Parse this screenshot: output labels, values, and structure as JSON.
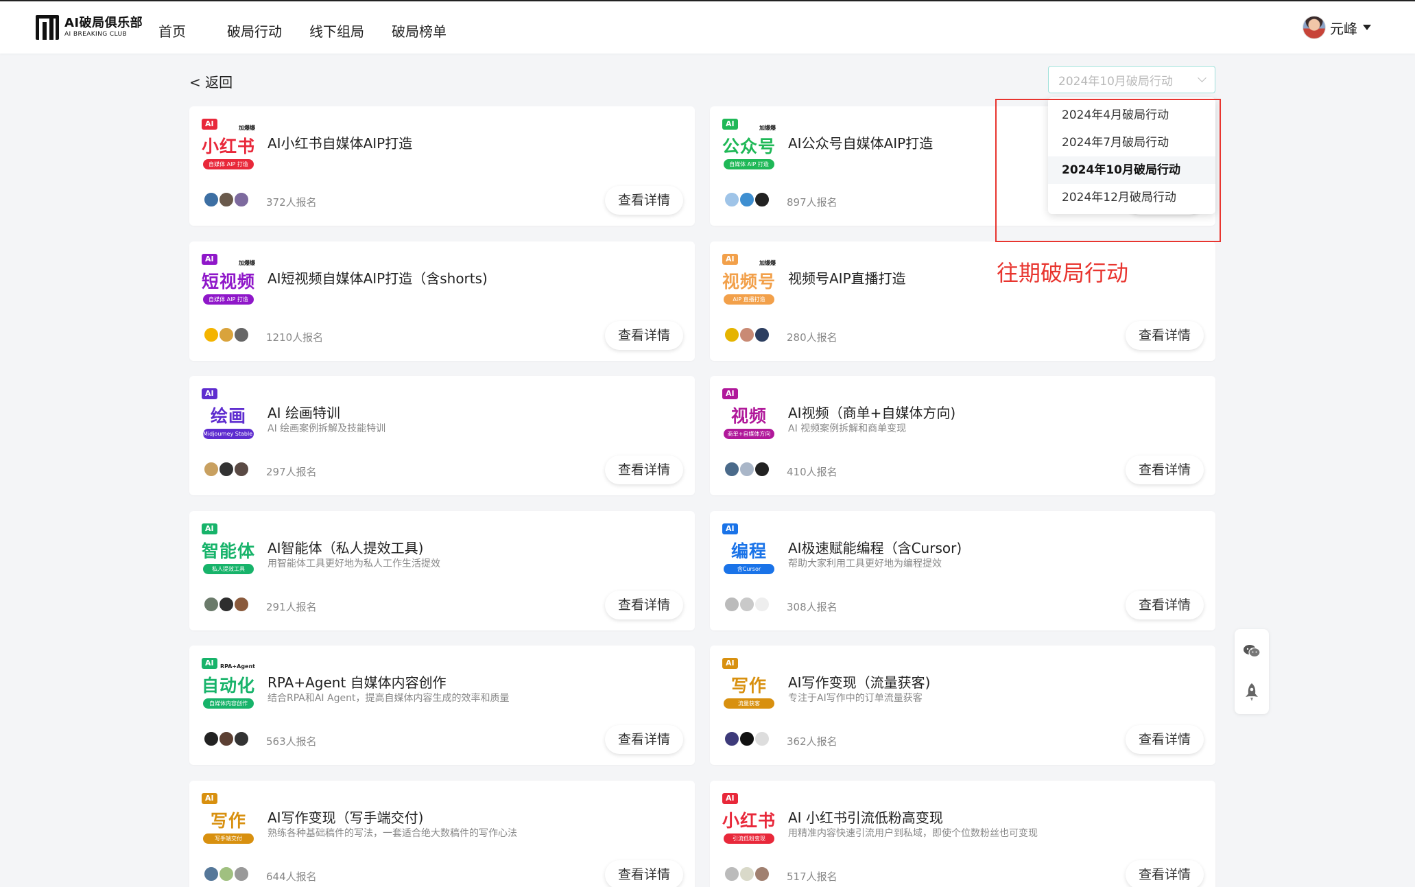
{
  "brand": {
    "name_cn": "AI破局俱乐部",
    "name_en": "AI BREAKING CLUB"
  },
  "nav": [
    {
      "label": "首页"
    },
    {
      "label": "破局行动"
    },
    {
      "label": "线下组局"
    },
    {
      "label": "破局榜单"
    }
  ],
  "user": {
    "name": "元峰"
  },
  "back_label": "< 返回",
  "period_select": {
    "value": "2024年10月破局行动",
    "options": [
      {
        "label": "2024年4月破局行动"
      },
      {
        "label": "2024年7月破局行动"
      },
      {
        "label": "2024年10月破局行动"
      },
      {
        "label": "2024年12月破局行动"
      }
    ]
  },
  "annotation": "往期破局行动",
  "detail_label": "查看详情",
  "courses": [
    {
      "title": "AI小红书自媒体AIP打造",
      "desc": "",
      "signup": "372人报名",
      "thumb": {
        "ai": "AI",
        "tag": "加爆爆",
        "title": "小红书",
        "sub": "自媒体 AIP 打造",
        "color": "#e8283a"
      }
    },
    {
      "title": "AI公众号自媒体AIP打造",
      "desc": "",
      "signup": "897人报名",
      "thumb": {
        "ai": "AI",
        "tag": "加爆爆",
        "title": "公众号",
        "sub": "自媒体 AIP 打造",
        "color": "#1fb857"
      }
    },
    {
      "title": "AI短视频自媒体AIP打造（含shorts)",
      "desc": "",
      "signup": "1210人报名",
      "thumb": {
        "ai": "AI",
        "tag": "加爆爆",
        "title": "短视频",
        "sub": "自媒体 AIP 打造",
        "color": "#8f17c9"
      }
    },
    {
      "title": "视频号AIP直播打造",
      "desc": "",
      "signup": "280人报名",
      "thumb": {
        "ai": "AI",
        "tag": "加爆爆",
        "title": "视频号",
        "sub": "AIP 直播打造",
        "color": "#f2a04a"
      }
    },
    {
      "title": "AI 绘画特训",
      "desc": "AI 绘画案例拆解及技能特训",
      "signup": "297人报名",
      "thumb": {
        "ai": "AI",
        "tag": "",
        "title": "绘画",
        "sub": "Midjourney Stable Diffusion",
        "color": "#5e2ccf"
      }
    },
    {
      "title": "AI视频（商单+自媒体方向)",
      "desc": "AI 视频案例拆解和商单变现",
      "signup": "410人报名",
      "thumb": {
        "ai": "AI",
        "tag": "",
        "title": "视频",
        "sub": "商单+自媒体方向",
        "color": "#b0189a"
      }
    },
    {
      "title": "AI智能体（私人提效工具)",
      "desc": "用智能体工具更好地为私人工作生活提效",
      "signup": "291人报名",
      "thumb": {
        "ai": "AI",
        "tag": "",
        "title": "智能体",
        "sub": "私人提效工具",
        "color": "#17b36a"
      }
    },
    {
      "title": "AI极速赋能编程（含Cursor)",
      "desc": "帮助大家利用工具更好地为编程提效",
      "signup": "308人报名",
      "thumb": {
        "ai": "AI",
        "tag": "",
        "title": "编程",
        "sub": "含Cursor",
        "color": "#1a73e8"
      }
    },
    {
      "title": "RPA+Agent 自媒体内容创作",
      "desc": "结合RPA和AI Agent，提高自媒体内容生成的效率和质量",
      "signup": "563人报名",
      "thumb": {
        "ai": "AI",
        "tag": "RPA+Agent",
        "title": "自动化",
        "sub": "自媒体内容创作",
        "color": "#17b36a"
      }
    },
    {
      "title": "AI写作变现（流量获客)",
      "desc": "专注于AI写作中的订单流量获客",
      "signup": "362人报名",
      "thumb": {
        "ai": "AI",
        "tag": "",
        "title": "写作",
        "sub": "流量获客",
        "color": "#d8900f"
      }
    },
    {
      "title": "AI写作变现（写手端交付)",
      "desc": "熟练各种基础稿件的写法，一套适合绝大数稿件的写作心法",
      "signup": "644人报名",
      "thumb": {
        "ai": "AI",
        "tag": "",
        "title": "写作",
        "sub": "写手端交付",
        "color": "#d8900f"
      }
    },
    {
      "title": "AI 小红书引流低粉高变现",
      "desc": "用精准内容快速引流用户到私域，即使个位数粉丝也可变现",
      "signup": "517人报名",
      "thumb": {
        "ai": "AI",
        "tag": "",
        "title": "小红书",
        "sub": "引流低粉变现",
        "color": "#e8283a"
      }
    }
  ],
  "float_bar": [
    {
      "icon": "wechat-icon"
    },
    {
      "icon": "rocket-icon"
    }
  ]
}
